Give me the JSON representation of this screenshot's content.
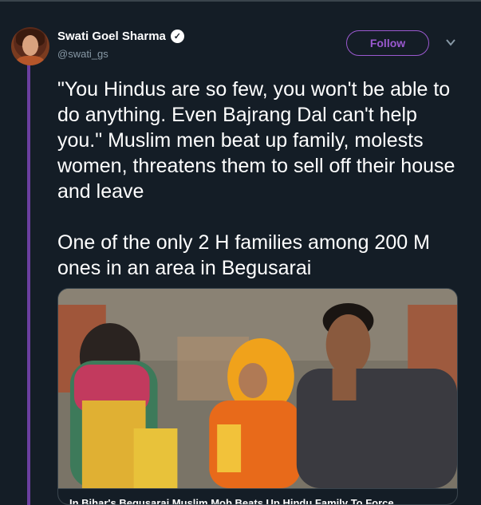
{
  "tweet": {
    "author_name": "Swati Goel Sharma",
    "author_handle": "@swati_gs",
    "follow_label": "Follow",
    "text": "\"You Hindus are so few, you won't be able to do anything. Even Bajrang Dal can't help you.\" Muslim men beat up family, molests women, threatens them to sell off their house and leave\n\nOne of the only 2 H families among 200 M ones in an area in Begusarai",
    "link_card_title": "In Bihar's Begusarai Muslim Mob Beats Up Hindu Family To Force"
  },
  "icons": {
    "verified": "verified-badge-icon",
    "more": "chevron-down-icon"
  },
  "colors": {
    "background": "#141d26",
    "accent": "#9b59d0",
    "thread_line": "#6b3fa0",
    "secondary_text": "#8899a6"
  }
}
